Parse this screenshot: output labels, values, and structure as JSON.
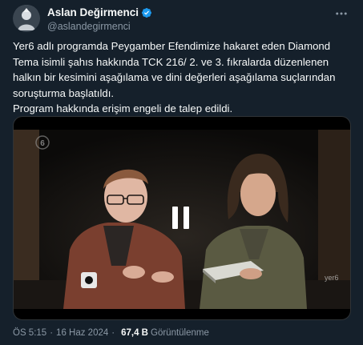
{
  "author": {
    "display_name": "Aslan Değirmenci",
    "handle": "@aslandegirmenci",
    "verified": true
  },
  "tweet": {
    "paragraph_1": "Yer6 adlı programda Peygamber Efendimize hakaret eden Diamond Tema isimli şahıs hakkında TCK 216/ 2. ve 3. fıkralarda düzenlenen halkın bir kesimini aşağılama ve dini değerleri aşağılama suçlarından soruşturma başlatıldı.",
    "paragraph_2": "Program hakkında erişim engeli de talep edildi."
  },
  "media": {
    "type": "video",
    "state": "paused",
    "watermark_left": "6",
    "watermark_right": "yer6"
  },
  "meta": {
    "time": "ÖS 5:15",
    "separator": "·",
    "date": "16 Haz 2024",
    "views_count": "67,4 B",
    "views_label": "Görüntülenme"
  },
  "colors": {
    "background": "#15202b",
    "text": "#f7f9f9",
    "secondary_text": "#8b98a5",
    "verified_badge": "#1d9bf0"
  },
  "icons": {
    "verified": "verified-badge-icon",
    "more": "more-options-icon",
    "pause": "pause-icon"
  }
}
